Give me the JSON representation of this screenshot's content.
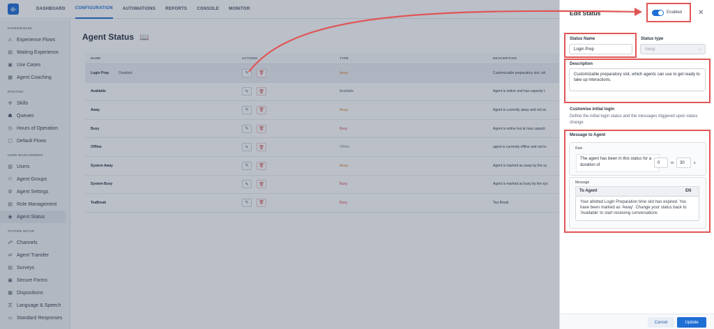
{
  "nav": {
    "items": [
      "DASHBOARD",
      "CONFIGURATION",
      "AUTOMATIONS",
      "REPORTS",
      "CONSOLE",
      "MONITOR"
    ]
  },
  "sidebar": {
    "experiences": {
      "title": "EXPERIENCES",
      "items": [
        "Experience Flows",
        "Waiting Experience",
        "Use Cases",
        "Agent Coaching"
      ]
    },
    "routing": {
      "title": "ROUTING",
      "items": [
        "Skills",
        "Queues",
        "Hours of Operation",
        "Default Flows"
      ]
    },
    "user_management": {
      "title": "USER MANAGEMENT",
      "items": [
        "Users",
        "Agent Groups",
        "Agent Settings",
        "Role Management",
        "Agent Status"
      ]
    },
    "system_setup": {
      "title": "SYSTEM SETUP",
      "items": [
        "Channels",
        "Agent Transfer",
        "Surveys",
        "Secure Forms",
        "Dispositions",
        "Language & Speech",
        "Standard Responses"
      ]
    }
  },
  "main": {
    "title": "Agent Status",
    "columns": {
      "name": "NAME",
      "actions": "ACTIONS",
      "type": "TYPE",
      "description": "DESCRIPTION"
    },
    "rows": [
      {
        "name": "Login Prep",
        "tag": "Disabled",
        "type": "Away",
        "description": "Customizable preparatory slot, wh"
      },
      {
        "name": "Available",
        "tag": "",
        "type": "Available",
        "description": "Agent is online and has capacity t"
      },
      {
        "name": "Away",
        "tag": "",
        "type": "Away",
        "description": "Agent is currently away and not av"
      },
      {
        "name": "Busy",
        "tag": "",
        "type": "Busy",
        "description": "Agent is online but at max capacit"
      },
      {
        "name": "Offline",
        "tag": "",
        "type": "Offline",
        "description": "agent is currently offline and not to"
      },
      {
        "name": "System Away",
        "tag": "",
        "type": "Away",
        "description": "Agent is marked as away by the sy"
      },
      {
        "name": "System Busy",
        "tag": "",
        "type": "Busy",
        "description": "Agent is marked as busy by the sys"
      },
      {
        "name": "TeaBreak",
        "tag": "",
        "type": "Busy",
        "description": "Tea Break"
      }
    ]
  },
  "panel": {
    "title": "Edit Status",
    "toggle_label": "Enabled",
    "status_name_label": "Status Name",
    "status_name_value": "Login Prep",
    "status_type_label": "Status type",
    "status_type_value": "Away",
    "description_label": "Description",
    "description_value": "Customizable preparatory slot, which agents can use to get ready to take up interactions.",
    "initial_login_label": "Customise initial login",
    "initial_login_sub": "Define the initial login status and the messages triggered upon status change",
    "message_to_agent_label": "Message to Agent",
    "rule_label": "Rule",
    "rule_text": "The agent has been in this status for a duration of",
    "rule_hours": "0",
    "rule_hours_unit": "m",
    "rule_minutes": "30",
    "rule_minutes_unit": "s",
    "message_label": "Message",
    "to_agent_label": "To Agent",
    "lang": "EN",
    "message_body": "Your allotted Login Preparation time slot has expired. You have been marked as 'Away'. Change your status back to 'Available' to start receiving conversations",
    "cancel_label": "Cancel",
    "update_label": "Update"
  },
  "colors": {
    "accent": "#1f6ed4",
    "annotation": "#e05555",
    "away": "#e6852c",
    "busy": "#e04848"
  }
}
